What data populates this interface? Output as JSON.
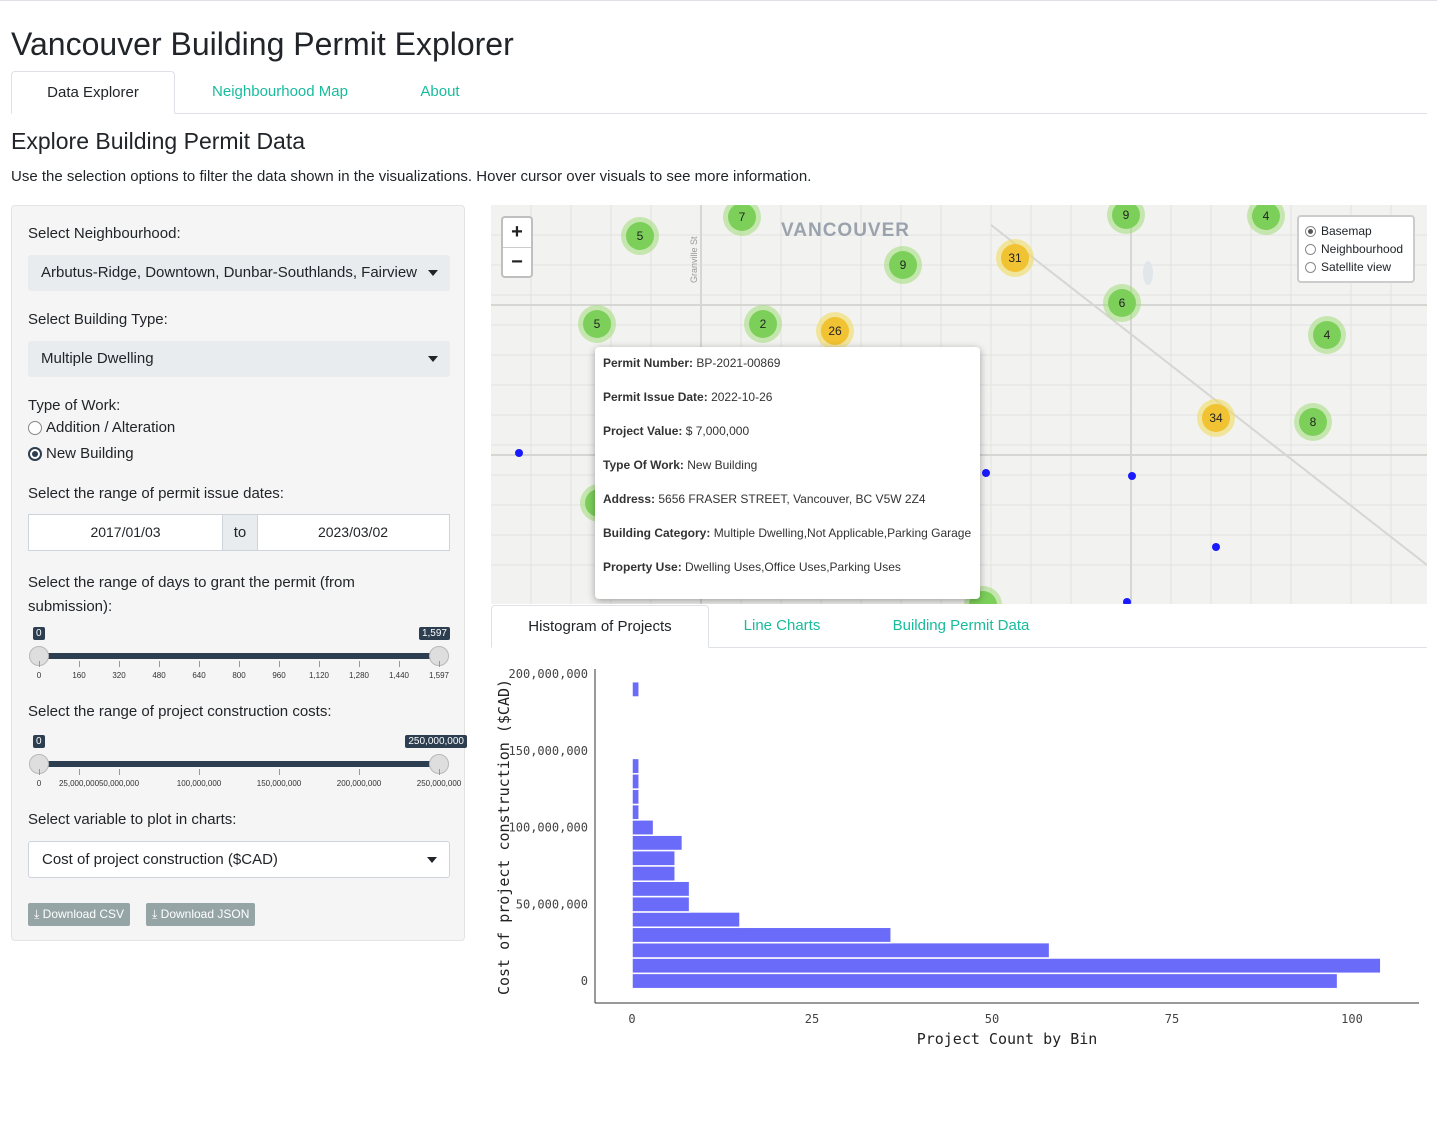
{
  "app": {
    "title": "Vancouver Building Permit Explorer"
  },
  "main_tabs": [
    {
      "label": "Data Explorer",
      "active": true
    },
    {
      "label": "Neighbourhood Map",
      "active": false
    },
    {
      "label": "About",
      "active": false
    }
  ],
  "page": {
    "heading": "Explore Building Permit Data",
    "intro": "Use the selection options to filter the data shown in the visualizations. Hover cursor over visuals to see more information."
  },
  "filters": {
    "neighbourhood_label": "Select Neighbourhood:",
    "neighbourhood_value": "Arbutus-Ridge, Downtown, Dunbar-Southlands, Fairview",
    "building_type_label": "Select Building Type:",
    "building_type_value": "Multiple Dwelling",
    "work_type_label": "Type of Work:",
    "work_type_options": [
      {
        "label": "Addition / Alteration",
        "checked": false
      },
      {
        "label": "New Building",
        "checked": true
      }
    ],
    "date_range_label": "Select the range of permit issue dates:",
    "date_start": "2017/01/03",
    "date_sep": "to",
    "date_end": "2023/03/02",
    "days_label": "Select the range of days to grant the permit (from submission):",
    "days_min_label": "0",
    "days_max_label": "1,597",
    "days_range": [
      0,
      1597
    ],
    "days_ticks": [
      "0",
      "160",
      "320",
      "480",
      "640",
      "800",
      "960",
      "1,120",
      "1,280",
      "1,440",
      "1,597"
    ],
    "cost_label": "Select the range of project construction costs:",
    "cost_min_label": "0",
    "cost_max_label": "250,000,000",
    "cost_range": [
      0,
      250000000
    ],
    "cost_ticks": [
      "0",
      "25,000,000",
      "50,000,000",
      "100,000,000",
      "150,000,000",
      "200,000,000",
      "250,000,000"
    ],
    "variable_label": "Select variable to plot in charts:",
    "variable_value": "Cost of project construction ($CAD)",
    "download_csv": "Download CSV",
    "download_json": "Download JSON"
  },
  "map": {
    "city_label": "VANCOUVER",
    "street_label": "Granville St",
    "zoom_in": "+",
    "zoom_out": "−",
    "layers": [
      {
        "label": "Basemap",
        "checked": true
      },
      {
        "label": "Neighbourhood",
        "checked": false
      },
      {
        "label": "Satellite view",
        "checked": false
      }
    ],
    "clusters": [
      {
        "count": "7",
        "color": "green"
      },
      {
        "count": "5",
        "color": "green"
      },
      {
        "count": "9",
        "color": "green"
      },
      {
        "count": "4",
        "color": "green"
      },
      {
        "count": "9",
        "color": "green"
      },
      {
        "count": "31",
        "color": "yellow"
      },
      {
        "count": "6",
        "color": "green"
      },
      {
        "count": "5",
        "color": "green"
      },
      {
        "count": "2",
        "color": "green"
      },
      {
        "count": "26",
        "color": "yellow"
      },
      {
        "count": "4",
        "color": "green"
      },
      {
        "count": "34",
        "color": "yellow"
      },
      {
        "count": "8",
        "color": "green"
      }
    ],
    "popup": {
      "permit_number_label": "Permit Number:",
      "permit_number": "BP-2021-00869",
      "issue_date_label": "Permit Issue Date:",
      "issue_date": "2022-10-26",
      "project_value_label": "Project Value:",
      "project_value": "$ 7,000,000",
      "type_of_work_label": "Type Of Work:",
      "type_of_work": "New Building",
      "address_label": "Address:",
      "address": "5656 FRASER STREET, Vancouver, BC V5W 2Z4",
      "building_category_label": "Building Category:",
      "building_category": "Multiple Dwelling,Not Applicable,Parking Garage",
      "property_use_label": "Property Use:",
      "property_use": "Dwelling Uses,Office Uses,Parking Uses"
    }
  },
  "chart_tabs": [
    {
      "label": "Histogram of Projects",
      "active": true
    },
    {
      "label": "Line Charts",
      "active": false
    },
    {
      "label": "Building Permit Data",
      "active": false
    }
  ],
  "chart_data": {
    "type": "bar",
    "orientation": "horizontal",
    "title": "",
    "xlabel": "Project Count by Bin",
    "ylabel": "Cost of project construction ($CAD)",
    "xlim": [
      0,
      105
    ],
    "ylim": [
      -5000000,
      200000000
    ],
    "xticks": [
      0,
      25,
      50,
      75,
      100
    ],
    "xtick_labels": [
      "0",
      "25",
      "50",
      "75",
      "100"
    ],
    "yticks": [
      0,
      50000000,
      100000000,
      150000000,
      200000000
    ],
    "ytick_labels": [
      "0",
      "50,000,000",
      "100,000,000",
      "150,000,000",
      "200,000,000"
    ],
    "bin_width": 10000000,
    "bins": [
      {
        "y0": -5000000,
        "y1": 5000000,
        "count": 98
      },
      {
        "y0": 5000000,
        "y1": 15000000,
        "count": 104
      },
      {
        "y0": 15000000,
        "y1": 25000000,
        "count": 58
      },
      {
        "y0": 25000000,
        "y1": 35000000,
        "count": 36
      },
      {
        "y0": 35000000,
        "y1": 45000000,
        "count": 15
      },
      {
        "y0": 45000000,
        "y1": 55000000,
        "count": 8
      },
      {
        "y0": 55000000,
        "y1": 65000000,
        "count": 8
      },
      {
        "y0": 65000000,
        "y1": 75000000,
        "count": 6
      },
      {
        "y0": 75000000,
        "y1": 85000000,
        "count": 6
      },
      {
        "y0": 85000000,
        "y1": 95000000,
        "count": 7
      },
      {
        "y0": 95000000,
        "y1": 105000000,
        "count": 3
      },
      {
        "y0": 105000000,
        "y1": 115000000,
        "count": 1
      },
      {
        "y0": 115000000,
        "y1": 125000000,
        "count": 1
      },
      {
        "y0": 125000000,
        "y1": 135000000,
        "count": 1
      },
      {
        "y0": 135000000,
        "y1": 145000000,
        "count": 1
      },
      {
        "y0": 185000000,
        "y1": 195000000,
        "count": 1
      }
    ],
    "bar_color": "#6b6bf9",
    "grid": false
  }
}
